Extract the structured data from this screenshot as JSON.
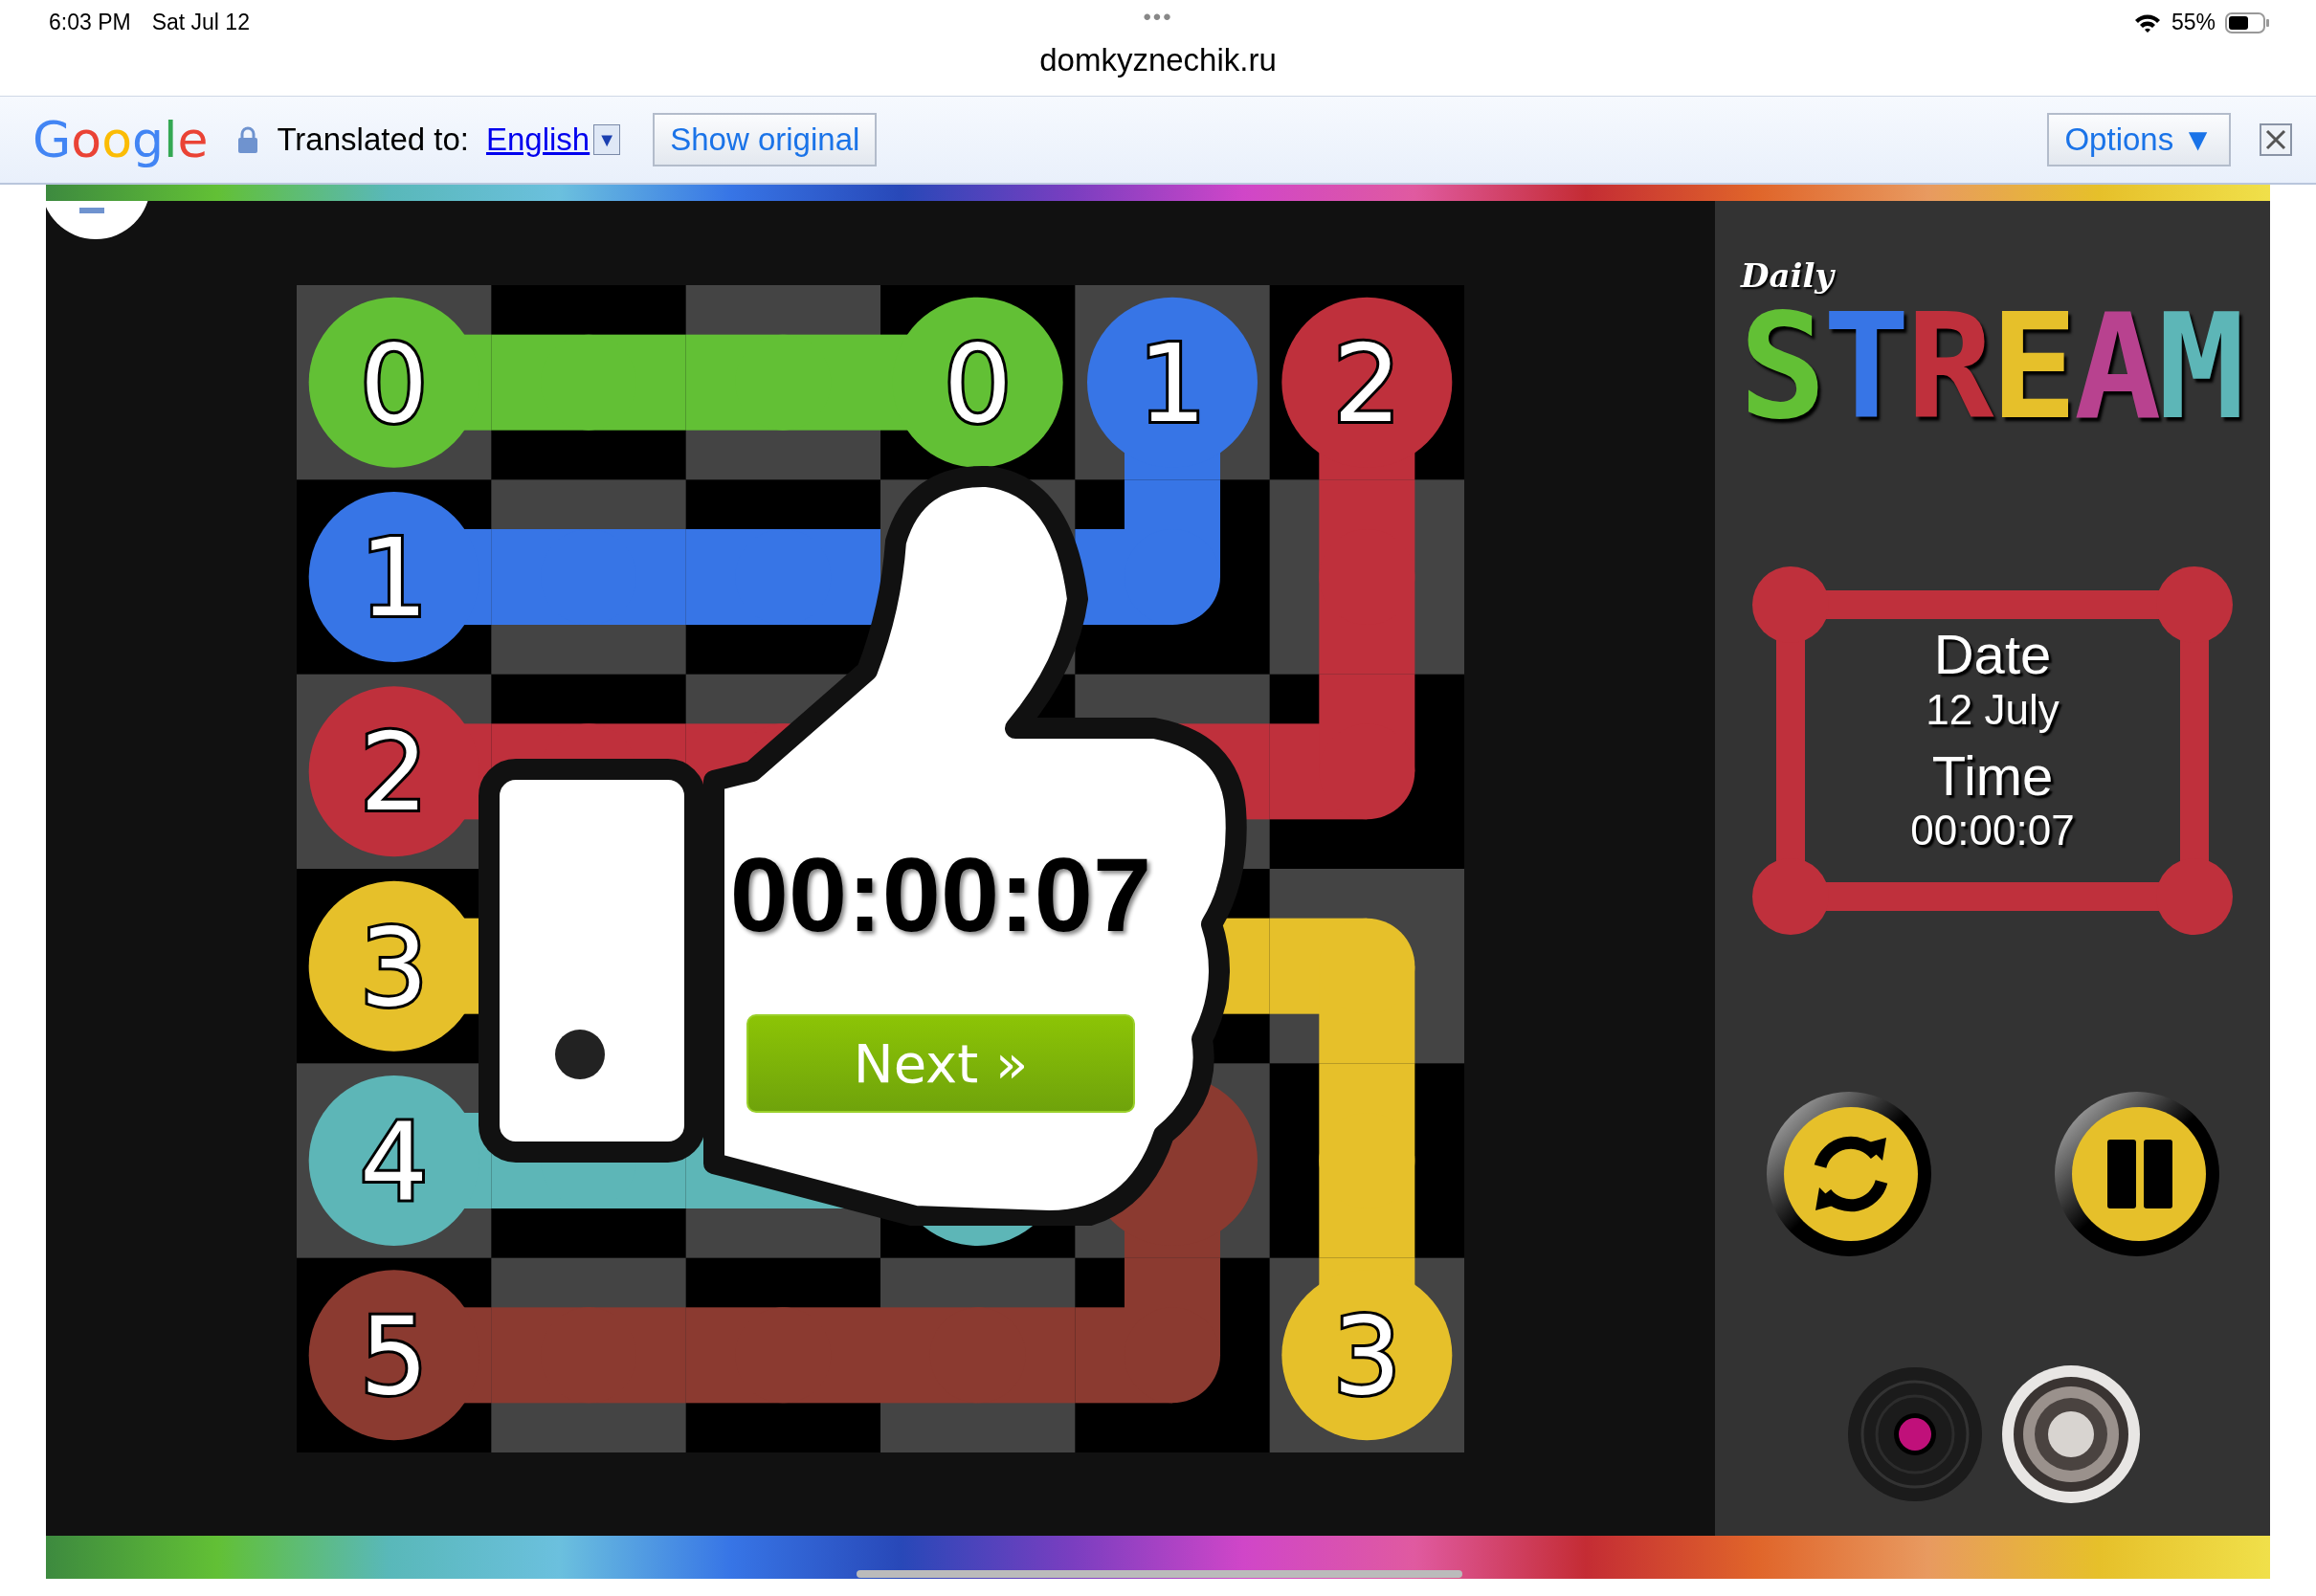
{
  "status_bar": {
    "time": "6:03 PM",
    "date": "Sat Jul 12",
    "dots": "•••",
    "battery": "55%"
  },
  "address_bar": {
    "url": "domkyznechik.ru"
  },
  "translate_bar": {
    "logo": [
      {
        "text": "G",
        "color": "#4285f4"
      },
      {
        "text": "o",
        "color": "#ea4335"
      },
      {
        "text": "o",
        "color": "#fbbc05"
      },
      {
        "text": "g",
        "color": "#4285f4"
      },
      {
        "text": "l",
        "color": "#34a853"
      },
      {
        "text": "e",
        "color": "#ea4335"
      }
    ],
    "label": "Translated to:",
    "language": "English",
    "language_caret": "▼",
    "show_original": "Show original",
    "options": "Options ▼"
  },
  "game": {
    "board": {
      "rows": [
        {
          "cells": [
            {
              "kind": "end",
              "color": "#62c035",
              "label": "0"
            },
            {
              "kind": "pipe",
              "color": "#62c035"
            },
            {
              "kind": "pipe",
              "color": "#62c035"
            },
            {
              "kind": "end",
              "color": "#62c035",
              "label": "0"
            },
            {
              "kind": "end",
              "color": "#3775e6",
              "label": "1"
            },
            {
              "kind": "end",
              "color": "#bf303c",
              "label": "2"
            }
          ]
        },
        {
          "cells": [
            {
              "kind": "end",
              "color": "#3775e6",
              "label": "1"
            },
            {
              "kind": "pipe",
              "color": "#3775e6"
            },
            {
              "kind": "pipe",
              "color": "#3775e6"
            },
            {
              "kind": "covered"
            },
            {
              "kind": "pipe",
              "color": "#3775e6"
            },
            {
              "kind": "pipe",
              "color": "#bf303c"
            }
          ]
        },
        {
          "cells": [
            {
              "kind": "end",
              "color": "#bf303c",
              "label": "2"
            },
            {
              "kind": "pipe",
              "color": "#bf303c"
            },
            {
              "kind": "pipe",
              "color": "#bf303c"
            },
            {
              "kind": "covered"
            },
            {
              "kind": "pipe",
              "color": "#bf303c"
            },
            {
              "kind": "pipe",
              "color": "#bf303c"
            }
          ]
        },
        {
          "cells": [
            {
              "kind": "end",
              "color": "#e6c02a",
              "label": "3"
            },
            {
              "kind": "covered"
            },
            {
              "kind": "covered"
            },
            {
              "kind": "covered"
            },
            {
              "kind": "pipe",
              "color": "#e6c02a"
            },
            {
              "kind": "pipe",
              "color": "#e6c02a"
            }
          ]
        },
        {
          "cells": [
            {
              "kind": "end",
              "color": "#5db6b7",
              "label": "4"
            },
            {
              "kind": "pipe",
              "color": "#5db6b7"
            },
            {
              "kind": "pipe",
              "color": "#5db6b7"
            },
            {
              "kind": "end",
              "color": "#5db6b7"
            },
            {
              "kind": "end",
              "color": "#8b3a30"
            },
            {
              "kind": "pipe",
              "color": "#e6c02a"
            }
          ]
        },
        {
          "cells": [
            {
              "kind": "end",
              "color": "#8b3a30",
              "label": "5"
            },
            {
              "kind": "pipe",
              "color": "#8b3a30"
            },
            {
              "kind": "pipe",
              "color": "#8b3a30"
            },
            {
              "kind": "pipe",
              "color": "#8b3a30"
            },
            {
              "kind": "pipe",
              "color": "#8b3a30"
            },
            {
              "kind": "end",
              "color": "#e6c02a",
              "label": "3"
            }
          ]
        }
      ]
    },
    "overlay": {
      "time": "00:00:07",
      "next": "Next »"
    }
  },
  "panel": {
    "logo_script": "Daily",
    "logo": [
      {
        "text": "S",
        "color": "#62c035"
      },
      {
        "text": "T",
        "color": "#3775e6"
      },
      {
        "text": "R",
        "color": "#bf303c"
      },
      {
        "text": "E",
        "color": "#e6c02a"
      },
      {
        "text": "A",
        "color": "#b8428f"
      },
      {
        "text": "M",
        "color": "#5db6b7"
      }
    ],
    "date_label": "Date",
    "date": "12 July",
    "time_label": "Time",
    "time": "00:00:07",
    "controls": [
      {
        "kind": "restart"
      },
      {
        "kind": "pause"
      }
    ],
    "sound": [
      {
        "kind": "music"
      },
      {
        "kind": "sound"
      }
    ]
  }
}
